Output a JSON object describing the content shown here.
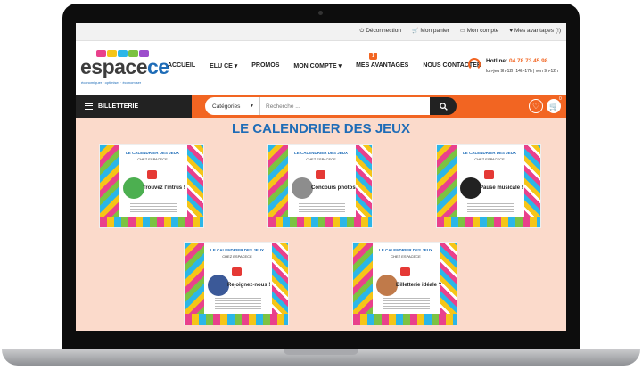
{
  "toplinks": [
    {
      "icon": "power-icon",
      "label": "Déconnection"
    },
    {
      "icon": "cart-icon",
      "label": "Mon panier"
    },
    {
      "icon": "card-icon",
      "label": "Mon compte"
    },
    {
      "icon": "heart-icon",
      "label": "Mes avantages (!)"
    }
  ],
  "logo": {
    "word_a": "espace",
    "word_b": "ce",
    "tagline": "économiquer · optimiser · économiser"
  },
  "menu": [
    "ACCUEIL",
    "ELU CE ▾",
    "PROMOS",
    "MON COMPTE ▾",
    "MES AVANTAGES",
    "NOUS CONTACTER"
  ],
  "menu_badge": "1",
  "hotline": {
    "label": "Hotline:",
    "phone": "04 78 73 45 98",
    "hours": "lun-jeu 9h-12h 14h-17h | ven 9h-12h"
  },
  "navbar": {
    "billetterie": "BILLETTERIE",
    "categories": "Catégories",
    "search_placeholder": "Recherche ...",
    "cart_count": "0"
  },
  "page_title": "LE CALENDRIER DES JEUX",
  "cards": [
    {
      "header": "LE CALENDRIER DES JEUX",
      "sub": "CHEZ ESPACECE",
      "label": "Trouvez l'intrus !",
      "pic_color": "#4caf50"
    },
    {
      "header": "LE CALENDRIER DES JEUX",
      "sub": "CHEZ ESPACECE",
      "label": "Concours photos !",
      "pic_color": "#8d8d8d"
    },
    {
      "header": "LE CALENDRIER DES JEUX",
      "sub": "CHEZ ESPACECE",
      "label": "Pause musicale !",
      "pic_color": "#222222"
    },
    {
      "header": "LE CALENDRIER DES JEUX",
      "sub": "CHEZ ESPACECE",
      "label": "Rejoignez-nous !",
      "pic_color": "#3b5998"
    },
    {
      "header": "LE CALENDRIER DES JEUX",
      "sub": "CHEZ ESPACECE",
      "label": "Billetterie idéale ?",
      "pic_color": "#c07a4a"
    }
  ]
}
